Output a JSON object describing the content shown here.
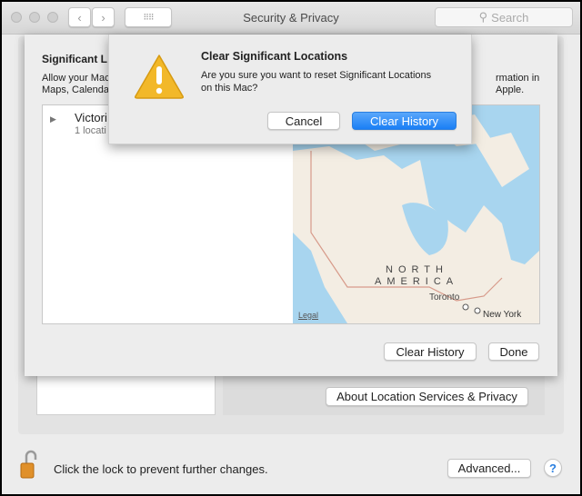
{
  "window": {
    "title": "Security & Privacy",
    "search_placeholder": "Search"
  },
  "sheet": {
    "heading": "Significant L",
    "desc_line1_left": "Allow your Mac",
    "desc_line2_left": "Maps, Calenda",
    "desc_line1_right": "rmation in",
    "desc_line2_right": "Apple.",
    "list": [
      {
        "name": "Victori",
        "detail": "1 locati"
      }
    ],
    "map": {
      "region_line1": "NORTH",
      "region_line2": "AMERICA",
      "city1": "Toronto",
      "city2": "New York",
      "legal": "Legal"
    },
    "clear_history": "Clear History",
    "done": "Done"
  },
  "alert": {
    "title": "Clear Significant Locations",
    "message_line1": "Are you sure you want to reset Significant Locations",
    "message_line2": "on this Mac?",
    "cancel": "Cancel",
    "confirm": "Clear History",
    "icon": "warning-icon"
  },
  "background": {
    "about_button": "About Location Services & Privacy"
  },
  "footer": {
    "lock_text": "Click the lock to prevent further changes.",
    "advanced": "Advanced...",
    "help": "?"
  },
  "colors": {
    "accent": "#1a7ff5",
    "water": "#a8d5ef",
    "land": "#f3ede3"
  }
}
